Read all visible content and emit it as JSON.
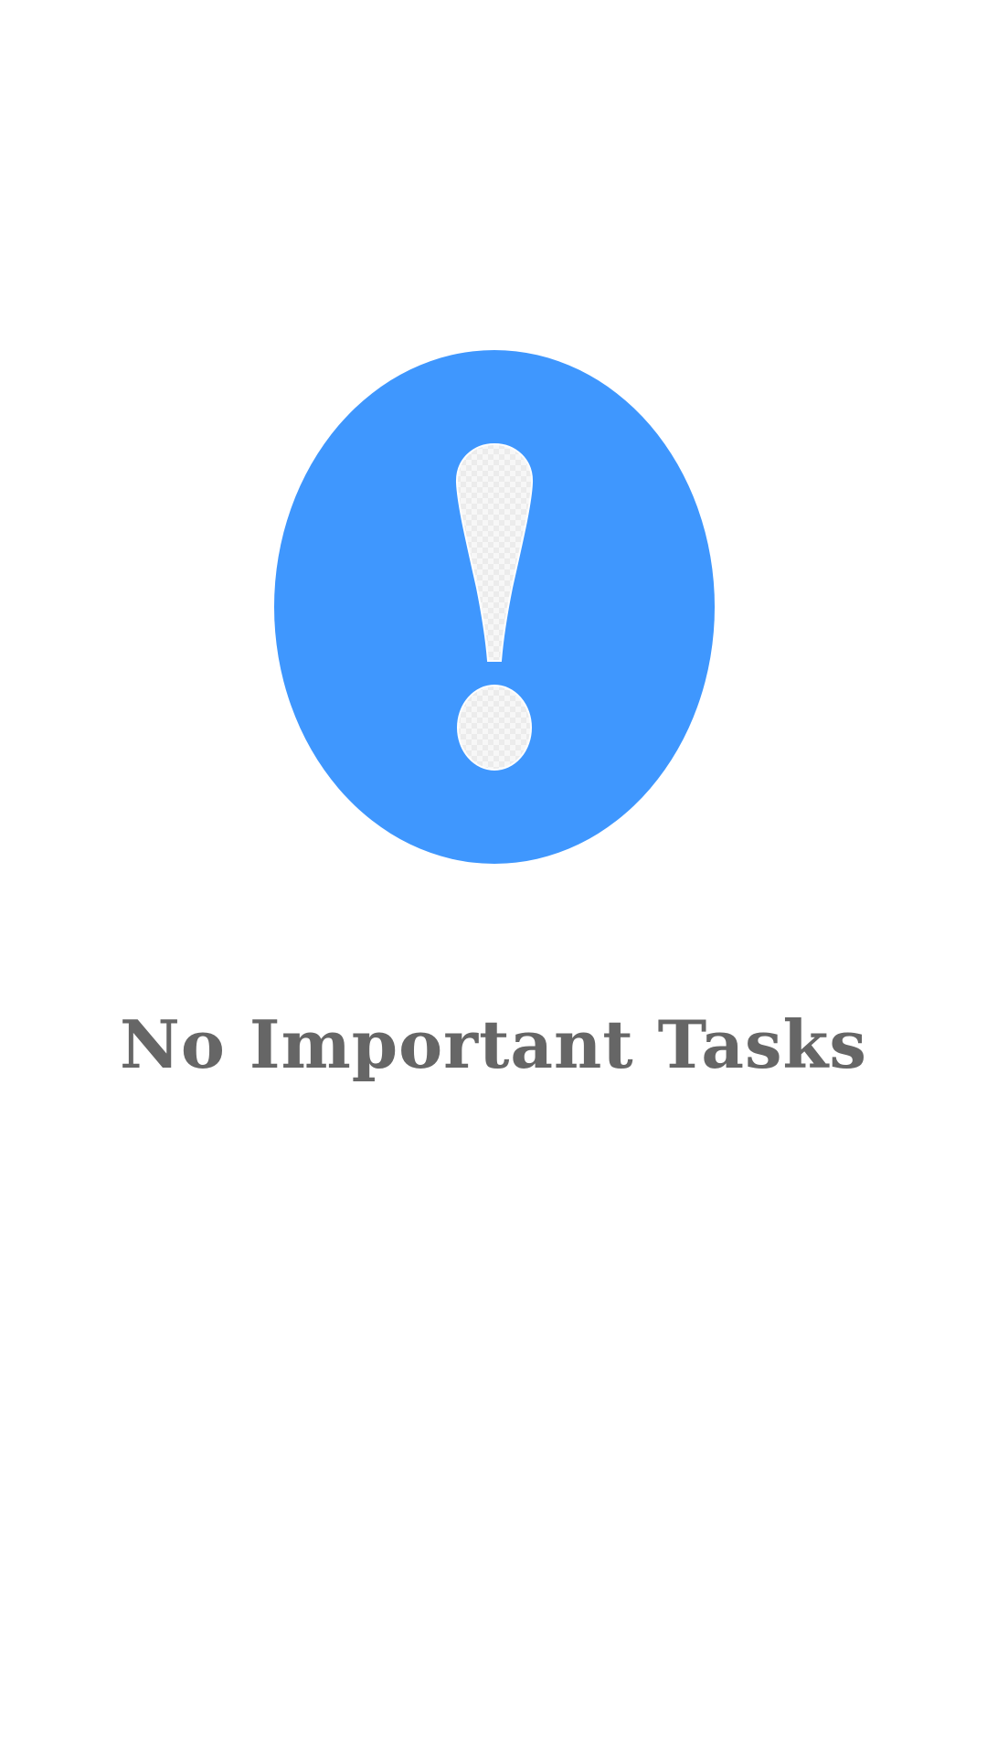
{
  "empty_state": {
    "icon": "exclamation-circle-icon",
    "icon_color": "#3f97fe",
    "glyph_color": "#f6f6f6",
    "message": "No Important Tasks",
    "message_color": "#666666"
  }
}
